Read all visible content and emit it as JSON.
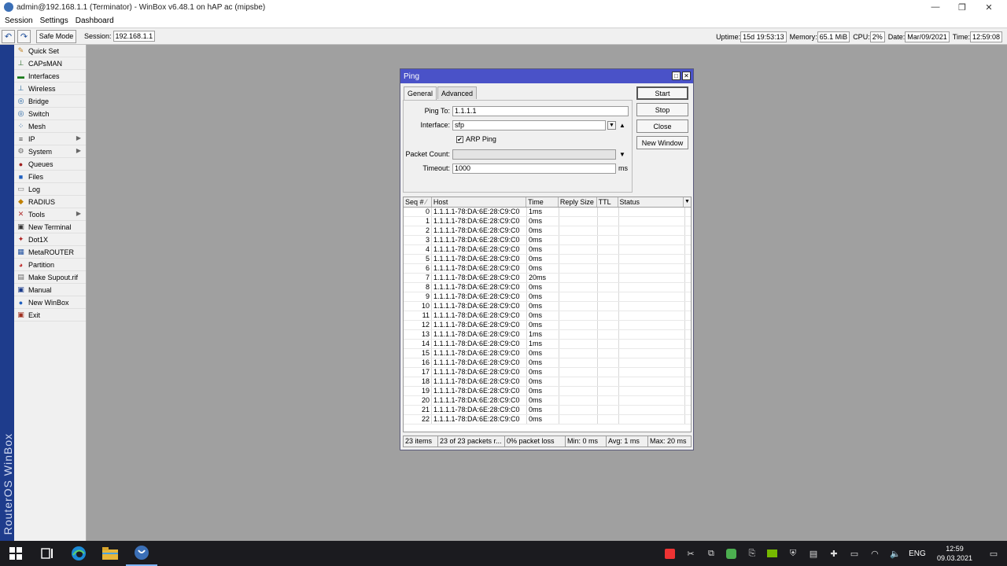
{
  "window": {
    "title": "admin@192.168.1.1 (Terminator) - WinBox v6.48.1 on hAP ac (mipsbe)",
    "min": "—",
    "max": "❐",
    "close": "✕"
  },
  "menu": [
    "Session",
    "Settings",
    "Dashboard"
  ],
  "toolbar": {
    "undo": "↶",
    "redo": "↷",
    "safe_mode": "Safe Mode",
    "session_label": "Session:",
    "session_value": "192.168.1.1",
    "uptime_label": "Uptime:",
    "uptime_value": "15d 19:53:13",
    "memory_label": "Memory:",
    "memory_value": "65.1 MiB",
    "cpu_label": "CPU:",
    "cpu_value": "2%",
    "date_label": "Date:",
    "date_value": "Mar/09/2021",
    "time_label": "Time:",
    "time_value": "12:59:08"
  },
  "sidebar": {
    "brand": "RouterOS WinBox",
    "items": [
      {
        "label": "Quick Set",
        "icon": "✎",
        "color": "#c08020",
        "arrow": ""
      },
      {
        "label": "CAPsMAN",
        "icon": "⊥",
        "color": "#2a6a2a",
        "arrow": ""
      },
      {
        "label": "Interfaces",
        "icon": "▬",
        "color": "#1a7a1a",
        "arrow": ""
      },
      {
        "label": "Wireless",
        "icon": "⊥",
        "color": "#2a6a9a",
        "arrow": ""
      },
      {
        "label": "Bridge",
        "icon": "◎",
        "color": "#2060a0",
        "arrow": ""
      },
      {
        "label": "Switch",
        "icon": "◎",
        "color": "#2060a0",
        "arrow": ""
      },
      {
        "label": "Mesh",
        "icon": "⁘",
        "color": "#2060a0",
        "arrow": ""
      },
      {
        "label": "IP",
        "icon": "≡",
        "color": "#444",
        "arrow": "▶"
      },
      {
        "label": "System",
        "icon": "⚙",
        "color": "#666",
        "arrow": "▶"
      },
      {
        "label": "Queues",
        "icon": "●",
        "color": "#a02020",
        "arrow": ""
      },
      {
        "label": "Files",
        "icon": "■",
        "color": "#2060c0",
        "arrow": ""
      },
      {
        "label": "Log",
        "icon": "▭",
        "color": "#777",
        "arrow": ""
      },
      {
        "label": "RADIUS",
        "icon": "◆",
        "color": "#c08000",
        "arrow": ""
      },
      {
        "label": "Tools",
        "icon": "✕",
        "color": "#b03030",
        "arrow": "▶"
      },
      {
        "label": "New Terminal",
        "icon": "▣",
        "color": "#333",
        "arrow": ""
      },
      {
        "label": "Dot1X",
        "icon": "✦",
        "color": "#b02020",
        "arrow": ""
      },
      {
        "label": "MetaROUTER",
        "icon": "▦",
        "color": "#2050a0",
        "arrow": ""
      },
      {
        "label": "Partition",
        "icon": "◕",
        "color": "#c03030",
        "arrow": ""
      },
      {
        "label": "Make Supout.rif",
        "icon": "▤",
        "color": "#666",
        "arrow": ""
      },
      {
        "label": "Manual",
        "icon": "▣",
        "color": "#1a3a8a",
        "arrow": ""
      },
      {
        "label": "New WinBox",
        "icon": "●",
        "color": "#2060c0",
        "arrow": ""
      },
      {
        "label": "Exit",
        "icon": "▣",
        "color": "#a03020",
        "arrow": ""
      }
    ]
  },
  "ping": {
    "title": "Ping",
    "tabs": [
      "General",
      "Advanced"
    ],
    "ping_to_label": "Ping To:",
    "ping_to_value": "1.1.1.1",
    "interface_label": "Interface:",
    "interface_value": "sfp",
    "arp_ping_label": "ARP Ping",
    "arp_ping_checked": true,
    "packet_count_label": "Packet Count:",
    "packet_count_value": "",
    "timeout_label": "Timeout:",
    "timeout_value": "1000",
    "timeout_unit": "ms",
    "buttons": [
      "Start",
      "Stop",
      "Close",
      "New Window"
    ],
    "columns": [
      "Seq #",
      "Host",
      "Time",
      "Reply Size",
      "TTL",
      "Status"
    ],
    "rows": [
      {
        "seq": "0",
        "host": "1.1.1.1-78:DA:6E:28:C9:C0",
        "time": "1ms"
      },
      {
        "seq": "1",
        "host": "1.1.1.1-78:DA:6E:28:C9:C0",
        "time": "0ms"
      },
      {
        "seq": "2",
        "host": "1.1.1.1-78:DA:6E:28:C9:C0",
        "time": "0ms"
      },
      {
        "seq": "3",
        "host": "1.1.1.1-78:DA:6E:28:C9:C0",
        "time": "0ms"
      },
      {
        "seq": "4",
        "host": "1.1.1.1-78:DA:6E:28:C9:C0",
        "time": "0ms"
      },
      {
        "seq": "5",
        "host": "1.1.1.1-78:DA:6E:28:C9:C0",
        "time": "0ms"
      },
      {
        "seq": "6",
        "host": "1.1.1.1-78:DA:6E:28:C9:C0",
        "time": "0ms"
      },
      {
        "seq": "7",
        "host": "1.1.1.1-78:DA:6E:28:C9:C0",
        "time": "20ms"
      },
      {
        "seq": "8",
        "host": "1.1.1.1-78:DA:6E:28:C9:C0",
        "time": "0ms"
      },
      {
        "seq": "9",
        "host": "1.1.1.1-78:DA:6E:28:C9:C0",
        "time": "0ms"
      },
      {
        "seq": "10",
        "host": "1.1.1.1-78:DA:6E:28:C9:C0",
        "time": "0ms"
      },
      {
        "seq": "11",
        "host": "1.1.1.1-78:DA:6E:28:C9:C0",
        "time": "0ms"
      },
      {
        "seq": "12",
        "host": "1.1.1.1-78:DA:6E:28:C9:C0",
        "time": "0ms"
      },
      {
        "seq": "13",
        "host": "1.1.1.1-78:DA:6E:28:C9:C0",
        "time": "1ms"
      },
      {
        "seq": "14",
        "host": "1.1.1.1-78:DA:6E:28:C9:C0",
        "time": "1ms"
      },
      {
        "seq": "15",
        "host": "1.1.1.1-78:DA:6E:28:C9:C0",
        "time": "0ms"
      },
      {
        "seq": "16",
        "host": "1.1.1.1-78:DA:6E:28:C9:C0",
        "time": "0ms"
      },
      {
        "seq": "17",
        "host": "1.1.1.1-78:DA:6E:28:C9:C0",
        "time": "0ms"
      },
      {
        "seq": "18",
        "host": "1.1.1.1-78:DA:6E:28:C9:C0",
        "time": "0ms"
      },
      {
        "seq": "19",
        "host": "1.1.1.1-78:DA:6E:28:C9:C0",
        "time": "0ms"
      },
      {
        "seq": "20",
        "host": "1.1.1.1-78:DA:6E:28:C9:C0",
        "time": "0ms"
      },
      {
        "seq": "21",
        "host": "1.1.1.1-78:DA:6E:28:C9:C0",
        "time": "0ms"
      },
      {
        "seq": "22",
        "host": "1.1.1.1-78:DA:6E:28:C9:C0",
        "time": "0ms"
      }
    ],
    "status": {
      "items": "23 items",
      "packets": "23 of 23 packets r...",
      "loss": "0% packet loss",
      "min": "Min: 0 ms",
      "avg": "Avg: 1 ms",
      "max": "Max: 20 ms"
    }
  },
  "taskbar": {
    "lang": "ENG",
    "time": "12:59",
    "date": "09.03.2021"
  }
}
